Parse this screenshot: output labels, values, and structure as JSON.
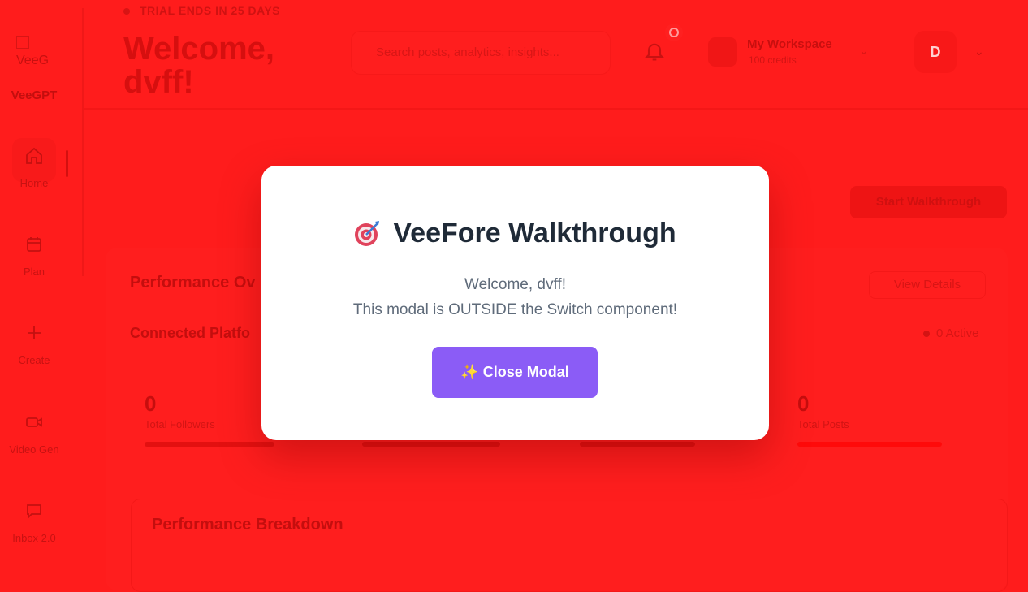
{
  "sidebar": {
    "logo_alt": "VeeG",
    "brand": "VeeGPT",
    "items": [
      {
        "label": "Home",
        "icon": "home-icon"
      },
      {
        "label": "Plan",
        "icon": "calendar-icon"
      },
      {
        "label": "Create",
        "icon": "plus-icon"
      },
      {
        "label": "Video Gen",
        "icon": "video-icon"
      },
      {
        "label": "Inbox 2.0",
        "icon": "message-icon"
      }
    ]
  },
  "header": {
    "trial": "TRIAL ENDS IN 25 DAYS",
    "welcome": "Welcome, dvff!",
    "search_placeholder": "Search posts, analytics, insights...",
    "notifications": "0",
    "workspace_name": "My Workspace",
    "workspace_credits": "100 credits",
    "avatar_letter": "D"
  },
  "main": {
    "walkthrough_button": "Start Walkthrough",
    "performance_title": "Performance Ov",
    "view_details": "View Details",
    "connected_title": "Connected Platfo",
    "active_count": "0 Active",
    "stats": [
      {
        "value": "0",
        "label": "Total Followers"
      },
      {
        "value": "0",
        "label": "Total Posts"
      }
    ],
    "breakdown_title": "Performance Breakdown"
  },
  "modal": {
    "title": "VeeFore Walkthrough",
    "line1": "Welcome, dvff!",
    "line2": "This modal is OUTSIDE the Switch component!",
    "button": "✨ Close Modal"
  },
  "colors": {
    "overlay": "#ff1c1c",
    "button": "#8b5cf6",
    "title": "#1f2a37"
  }
}
